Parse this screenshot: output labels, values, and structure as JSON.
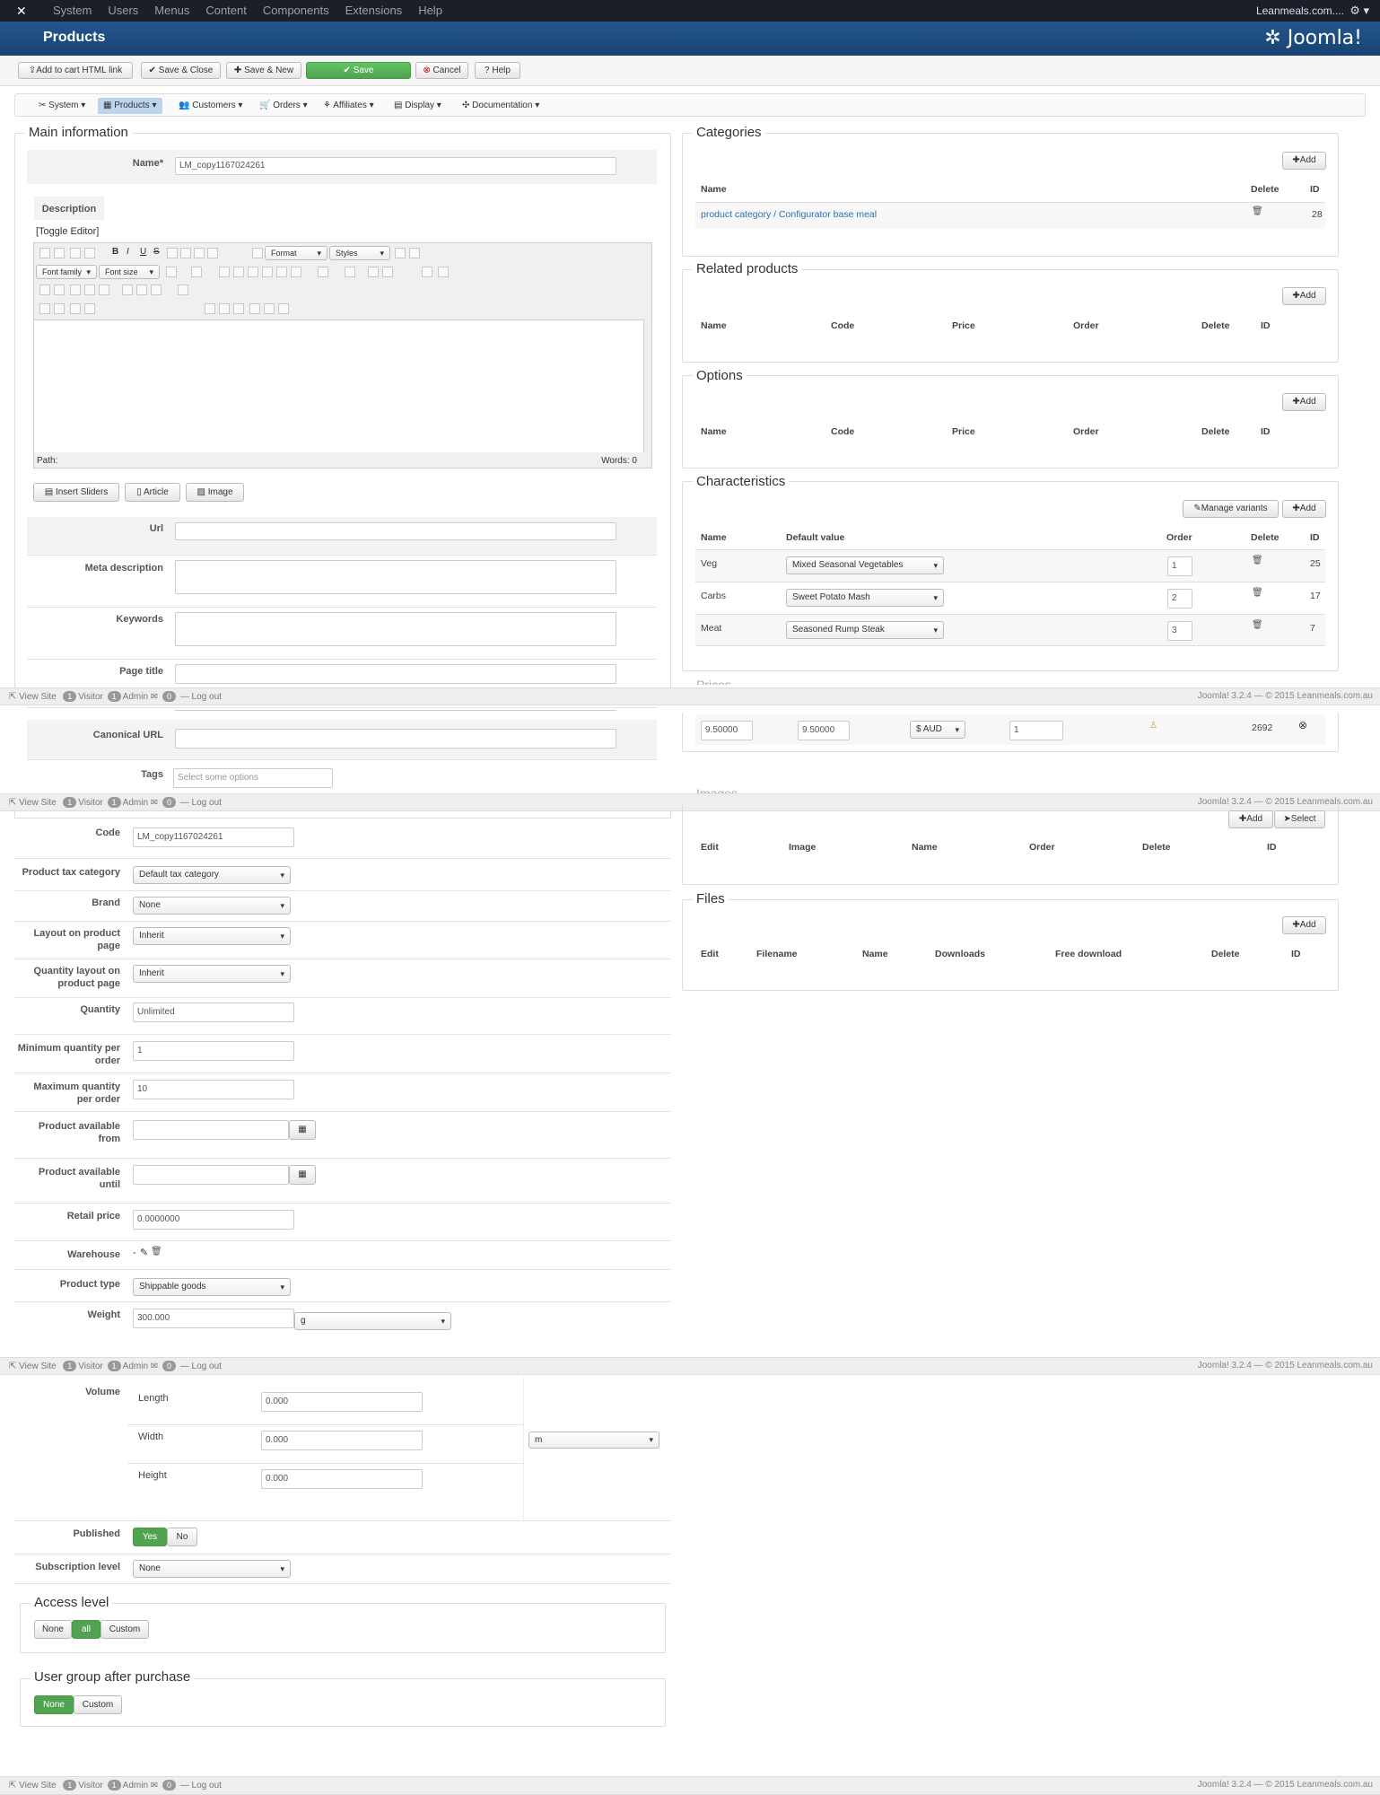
{
  "topbar": {
    "menu": [
      "System",
      "Users",
      "Menus",
      "Content",
      "Components",
      "Extensions",
      "Help"
    ],
    "site": "Leanmeals.com....",
    "logo_icon": "joomla-icon",
    "gear_icon": "gear-icon"
  },
  "header": {
    "title": "Products",
    "brand": "Joomla!"
  },
  "toolbar": {
    "add_to_cart": "Add to cart HTML link",
    "save_close": "Save & Close",
    "save_new": "Save & New",
    "save": "Save",
    "cancel": "Cancel",
    "help": "Help"
  },
  "nav": [
    "System",
    "Products",
    "Customers",
    "Orders",
    "Affiliates",
    "Display",
    "Documentation"
  ],
  "main": {
    "legend": "Main information",
    "name_label": "Name*",
    "name_value": "LM_copy1167024261",
    "description_tab": "Description",
    "toggle_editor": "[Toggle Editor]",
    "format": "Format",
    "styles": "Styles",
    "font_family": "Font family",
    "font_size": "Font size",
    "path": "Path:",
    "words": "Words: 0",
    "insert_sliders": "Insert Sliders",
    "article": "Article",
    "image": "Image",
    "url_label": "Url",
    "meta_label": "Meta description",
    "keywords_label": "Keywords",
    "page_title_label": "Page title",
    "canonical_label": "Canonical URL",
    "tags_label": "Tags",
    "tags_placeholder": "Select some options"
  },
  "details": {
    "code_label": "Code",
    "code_value": "LM_copy1167024261",
    "tax_label": "Product tax category",
    "tax_value": "Default tax category",
    "brand_label": "Brand",
    "brand_value": "None",
    "layout_label": "Layout on product page",
    "layout_value": "Inherit",
    "qty_layout_label": "Quantity layout on product page",
    "qty_layout_value": "Inherit",
    "quantity_label": "Quantity",
    "quantity_value": "Unlimited",
    "min_label": "Minimum quantity per order",
    "min_value": "1",
    "max_label": "Maximum quantity per order",
    "max_value": "10",
    "from_label": "Product available from",
    "until_label": "Product available until",
    "retail_label": "Retail price",
    "retail_value": "0.0000000",
    "warehouse_label": "Warehouse",
    "warehouse_value": "-",
    "type_label": "Product type",
    "type_value": "Shippable goods",
    "weight_label": "Weight",
    "weight_value": "300.000",
    "weight_unit": "g",
    "volume_label": "Volume",
    "length_label": "Length",
    "length_value": "0.000",
    "width_label": "Width",
    "width_value": "0.000",
    "height_label": "Height",
    "height_value": "0.000",
    "volume_unit": "m",
    "published_label": "Published",
    "yes": "Yes",
    "no": "No",
    "subscription_label": "Subscription level",
    "subscription_value": "None"
  },
  "access": {
    "legend": "Access level",
    "none": "None",
    "all": "all",
    "custom": "Custom"
  },
  "usergroup": {
    "legend": "User group after purchase",
    "none": "None",
    "custom": "Custom"
  },
  "categories": {
    "legend": "Categories",
    "add": "Add",
    "headers": [
      "Name",
      "Delete",
      "ID"
    ],
    "row": {
      "name": "product category / Configurator base meal",
      "id": "28"
    }
  },
  "related": {
    "legend": "Related products",
    "add": "Add",
    "headers": [
      "Name",
      "Code",
      "Price",
      "Order",
      "Delete",
      "ID"
    ]
  },
  "options": {
    "legend": "Options",
    "add": "Add",
    "headers": [
      "Name",
      "Code",
      "Price",
      "Order",
      "Delete",
      "ID"
    ]
  },
  "characteristics": {
    "legend": "Characteristics",
    "manage": "Manage variants",
    "add": "Add",
    "headers": [
      "Name",
      "Default value",
      "Order",
      "Delete",
      "ID"
    ],
    "rows": [
      {
        "name": "Veg",
        "value": "Mixed Seasonal Vegetables",
        "order": "1",
        "id": "25"
      },
      {
        "name": "Carbs",
        "value": "Sweet Potato Mash",
        "order": "2",
        "id": "17"
      },
      {
        "name": "Meat",
        "value": "Seasoned Rump Steak",
        "order": "3",
        "id": "7"
      }
    ]
  },
  "prices": {
    "legend": "Prices",
    "row": {
      "price1": "9.50000",
      "price2": "9.50000",
      "currency": "$ AUD",
      "qty": "1",
      "id": "2692"
    }
  },
  "images": {
    "legend": "Images",
    "add": "Add",
    "select": "Select",
    "headers": [
      "Edit",
      "Image",
      "Name",
      "Order",
      "Delete",
      "ID"
    ]
  },
  "files": {
    "legend": "Files",
    "add": "Add",
    "headers": [
      "Edit",
      "Filename",
      "Name",
      "Downloads",
      "Free download",
      "Delete",
      "ID"
    ]
  },
  "status": {
    "view_site": "View Site",
    "visitors": "1",
    "visitor": "Visitor",
    "admins": "1",
    "admin": "Admin",
    "messages": "0",
    "logout": "Log out",
    "version": "Joomla! 3.2.4 — © 2015 Leanmeals.com.au"
  }
}
